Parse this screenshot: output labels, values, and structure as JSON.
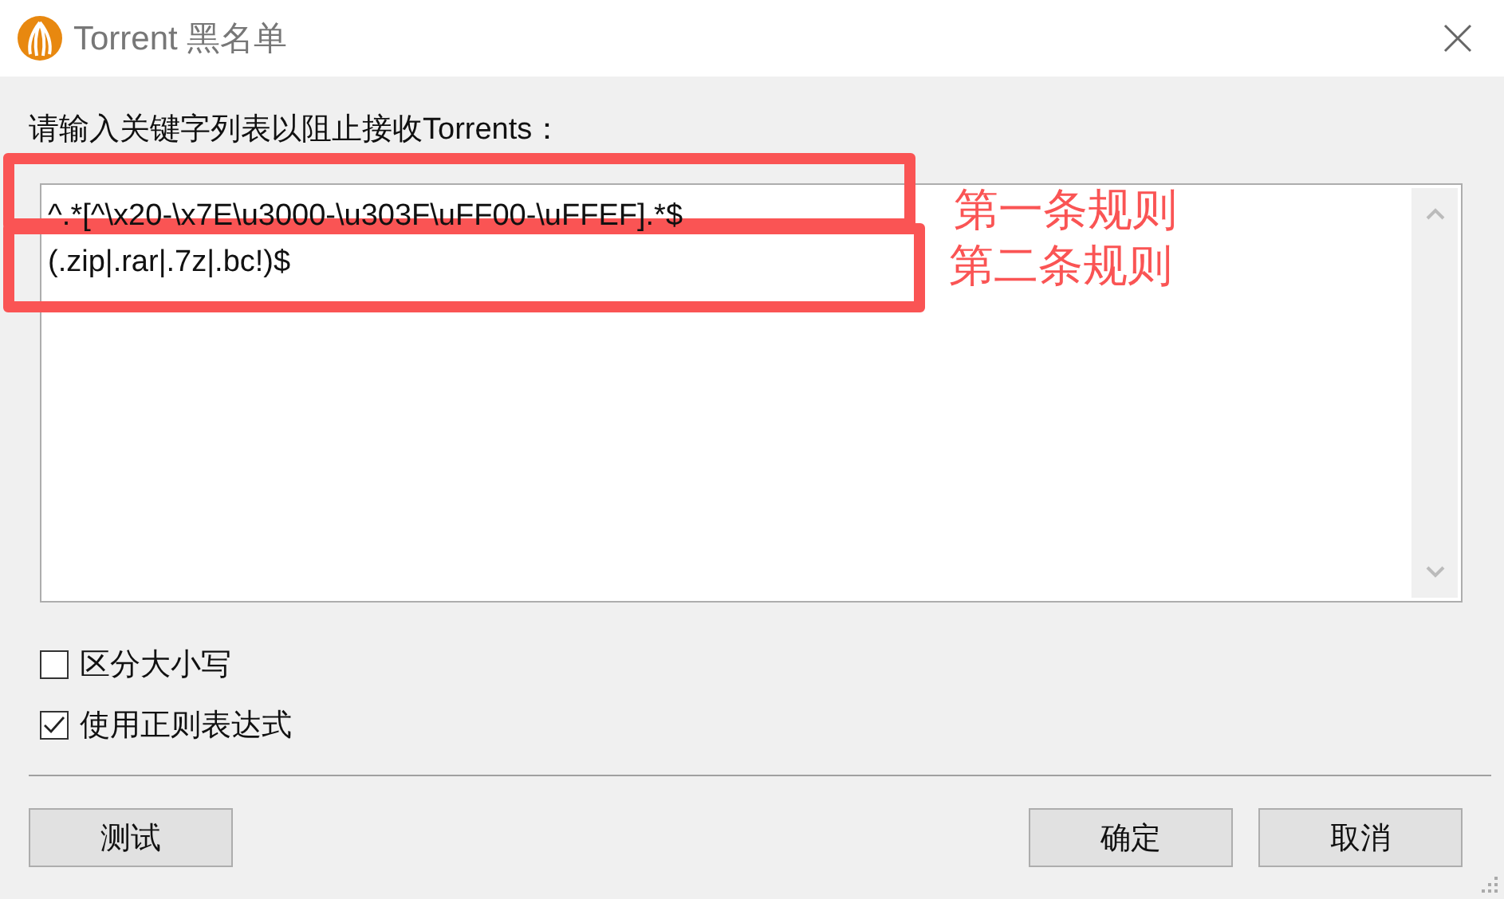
{
  "window": {
    "title": "Torrent 黑名单"
  },
  "prompt": "请输入关键字列表以阻止接收Torrents：",
  "rules": [
    "^.*[^\\x20-\\x7E\\u3000-\\u303F\\uFF00-\\uFFEF].*$",
    "(.zip|.rar|.7z|.bc!)$"
  ],
  "annotations": [
    "第一条规则",
    "第二条规则"
  ],
  "options": [
    {
      "label": "区分大小写",
      "checked": false
    },
    {
      "label": "使用正则表达式",
      "checked": true
    }
  ],
  "buttons": {
    "left": [
      "测试"
    ],
    "right": [
      "确定",
      "取消"
    ]
  }
}
